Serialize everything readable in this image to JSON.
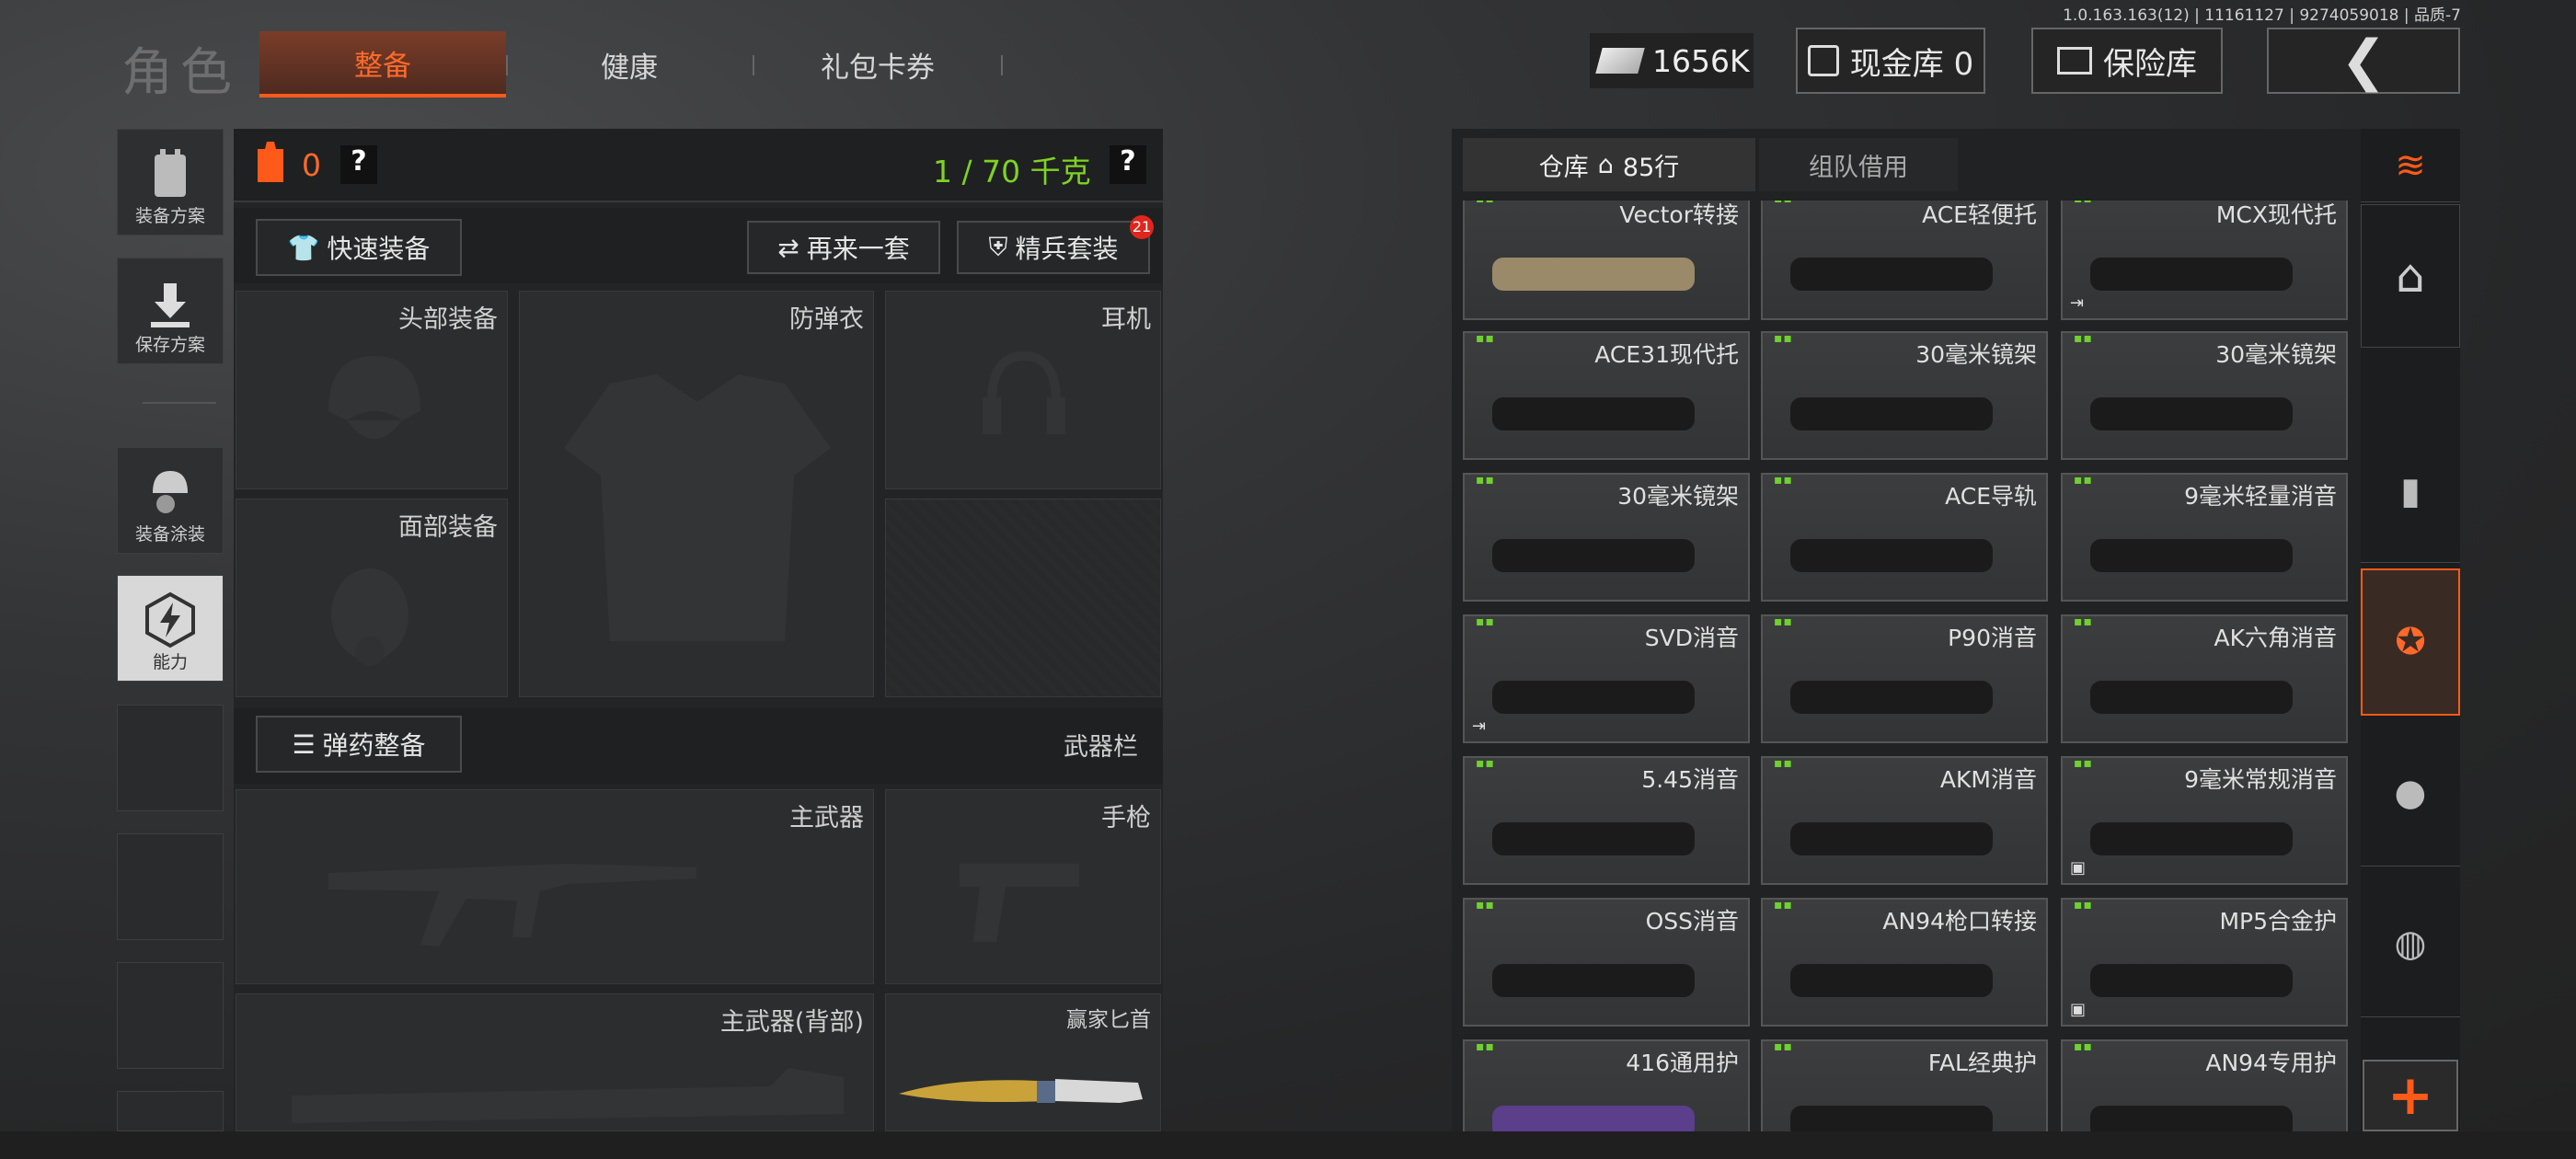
{
  "version": "1.0.163.163(12) | 11161127 | 9274059018 | 品质-7",
  "header": {
    "title": "角色",
    "tabs": [
      "整备",
      "健康",
      "礼包卡券"
    ],
    "active_tab": 0,
    "money": "1656K",
    "cash_vault": "现金库 0",
    "safe": "保险库"
  },
  "sidebar": {
    "items": [
      "装备方案",
      "保存方案",
      "装备涂装",
      "能力"
    ]
  },
  "equip": {
    "armor_count": "0",
    "weight": "1 / 70 千克",
    "help": "?",
    "quick_equip": "快速装备",
    "again": "再来一套",
    "elite": "精兵套装",
    "elite_badge": "21",
    "slots": {
      "head": "头部装备",
      "face": "面部装备",
      "armor": "防弹衣",
      "ear": "耳机",
      "main": "主武器",
      "pistol": "手枪",
      "back": "主武器(背部)",
      "knife": "赢家匕首"
    },
    "ammo_btn": "弹药整备",
    "weapon_bar": "武器栏"
  },
  "storage": {
    "tab_storage": "仓库",
    "rows": "85行",
    "tab_team": "组队借用",
    "items": [
      {
        "name": "Vector转接",
        "flag": ""
      },
      {
        "name": "ACE轻便托",
        "flag": ""
      },
      {
        "name": "MCX现代托",
        "flag": "exit"
      },
      {
        "name": "ACE31现代托",
        "flag": ""
      },
      {
        "name": "30毫米镜架",
        "flag": ""
      },
      {
        "name": "30毫米镜架",
        "flag": ""
      },
      {
        "name": "30毫米镜架",
        "flag": ""
      },
      {
        "name": "ACE导轨",
        "flag": ""
      },
      {
        "name": "9毫米轻量消音",
        "flag": ""
      },
      {
        "name": "SVD消音",
        "flag": "exit"
      },
      {
        "name": "P90消音",
        "flag": ""
      },
      {
        "name": "AK六角消音",
        "flag": ""
      },
      {
        "name": "5.45消音",
        "flag": ""
      },
      {
        "name": "AKM消音",
        "flag": ""
      },
      {
        "name": "9毫米常规消音",
        "flag": "box"
      },
      {
        "name": "OSS消音",
        "flag": ""
      },
      {
        "name": "AN94枪口转接",
        "flag": ""
      },
      {
        "name": "MP5合金护",
        "flag": "box"
      },
      {
        "name": "416通用护",
        "flag": ""
      },
      {
        "name": "FAL经典护",
        "flag": ""
      },
      {
        "name": "AN94专用护",
        "flag": ""
      }
    ]
  },
  "colors": {
    "accent": "#ff5a1a",
    "green": "#7ed321"
  }
}
